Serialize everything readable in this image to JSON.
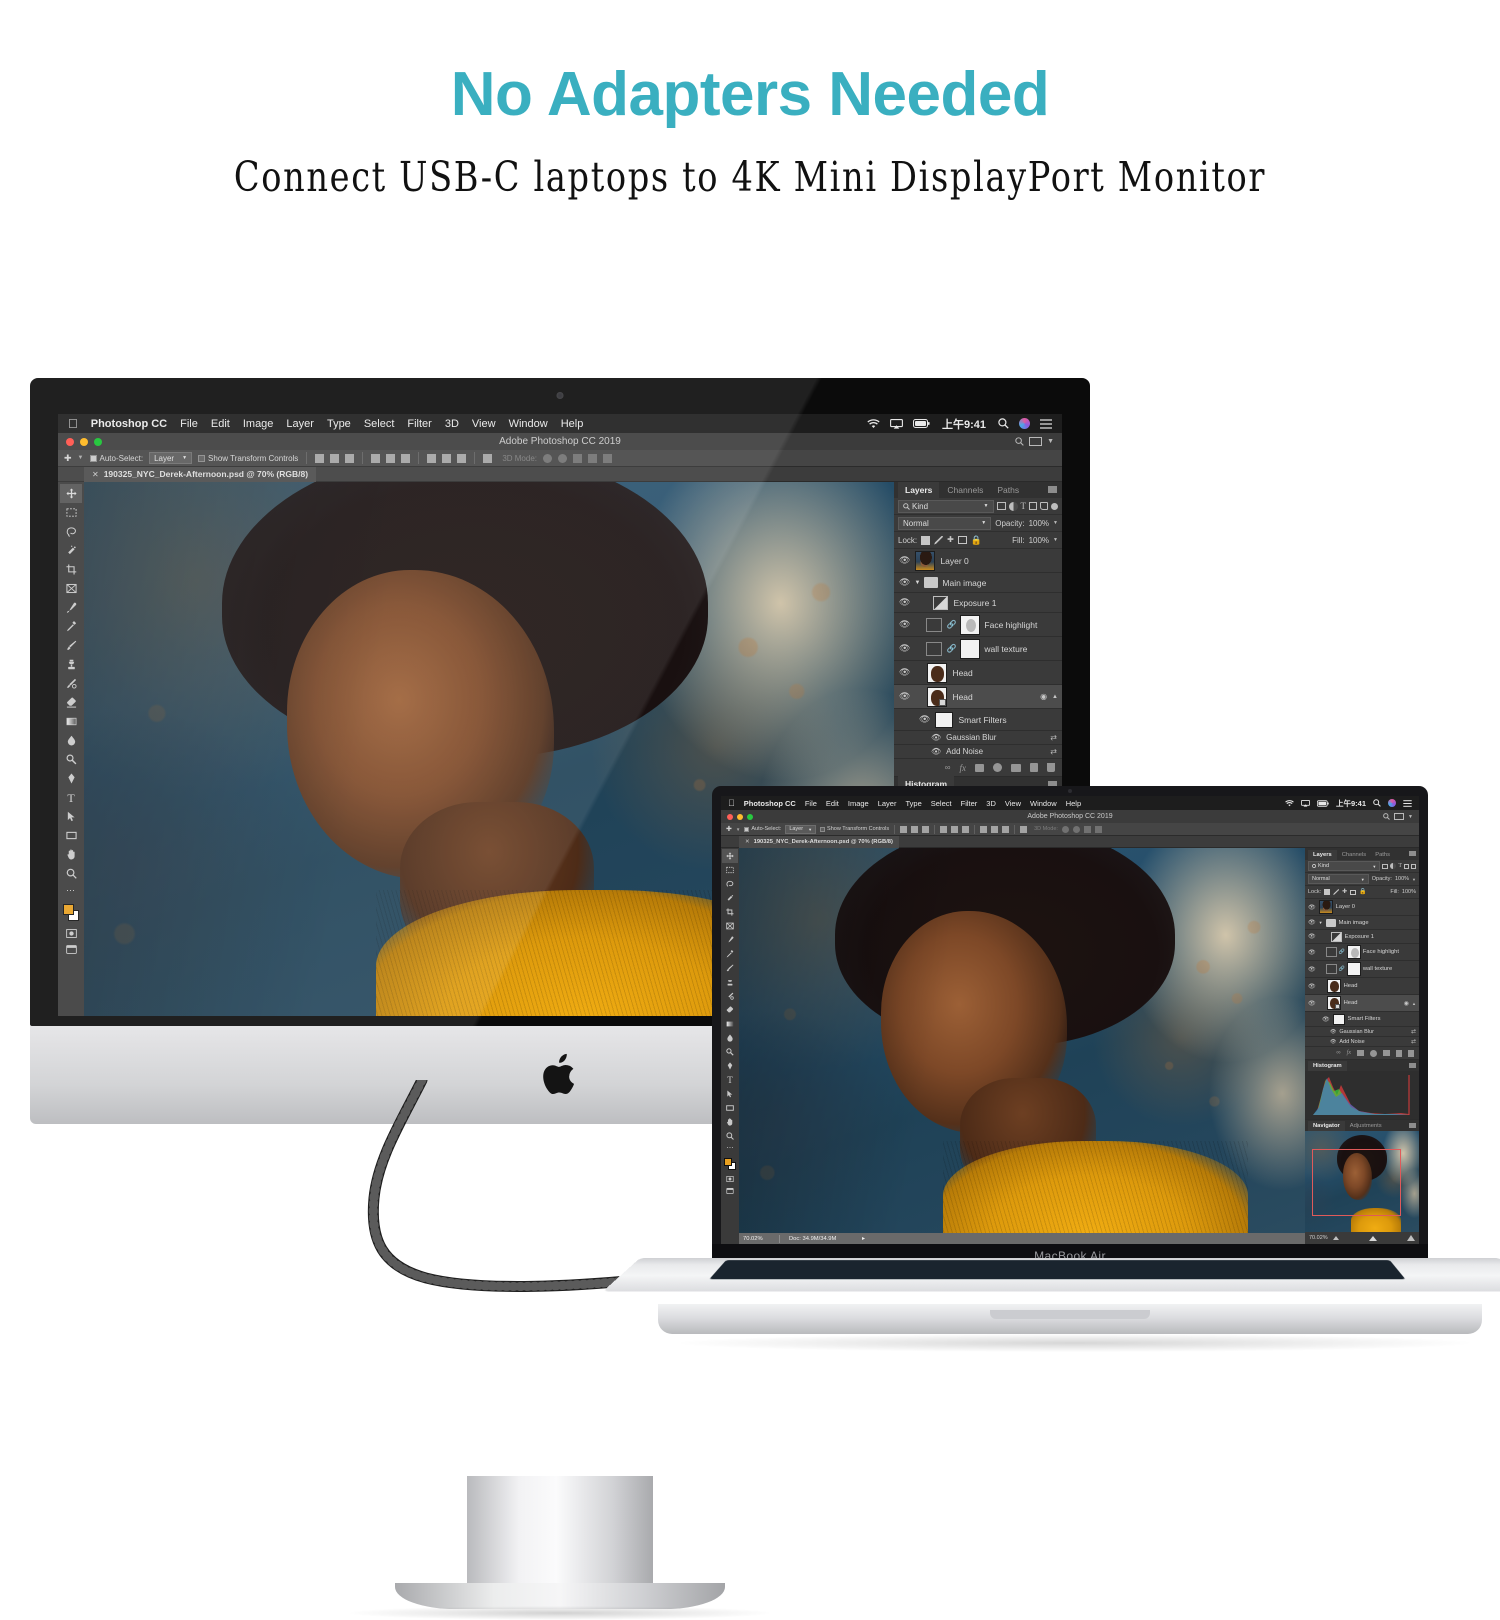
{
  "headline": "No Adapters Needed",
  "subheadline": "Connect USB-C laptops to 4K Mini DisplayPort Monitor",
  "colors": {
    "headline_teal": "#3aafc0",
    "subheadline_black": "#111111",
    "page_background": "#ffffff",
    "ps_panel_gray": "#3a3a3a",
    "ps_menubar_dark": "#1d1d1d",
    "ps_statusbar_gray": "#6a6a6a",
    "sweater_yellow": "#e8a020",
    "wall_blue": "#27506c",
    "nav_viewport_red": "#e05a5a"
  },
  "photoshop": {
    "menubar": {
      "apple_logo": "apple-logo-icon",
      "app_name": "Photoshop CC",
      "items": [
        "File",
        "Edit",
        "Image",
        "Layer",
        "Type",
        "Select",
        "Filter",
        "3D",
        "View",
        "Window",
        "Help"
      ],
      "status_icons": [
        "wifi-icon",
        "airplay-icon",
        "battery-icon"
      ],
      "clock": "上午9:41",
      "right_icons": [
        "search-icon",
        "siri-icon",
        "control-center-icon"
      ]
    },
    "window": {
      "title": "Adobe Photoshop CC 2019",
      "traffic_lights": [
        "close-button",
        "minimize-button",
        "zoom-button"
      ],
      "traffic_colors": [
        "#ff5f57",
        "#febc2e",
        "#28c840"
      ],
      "right_icons": [
        "search-icon",
        "workspace-icon",
        "chevron-down-icon"
      ]
    },
    "options_bar": {
      "tool_icon": "move-tool-icon",
      "auto_select_label": "Auto-Select:",
      "auto_select_checked": true,
      "auto_select_target": "Layer",
      "show_transform_label": "Show Transform Controls",
      "show_transform_checked": false,
      "align_groups": [
        3,
        3,
        3,
        3
      ],
      "mode_3d_label": "3D Mode:",
      "mode_3d_enabled": false,
      "mode_3d_icons": [
        "orbit-3d-icon",
        "roll-3d-icon",
        "pan-3d-icon",
        "slide-3d-icon",
        "scale-3d-icon"
      ]
    },
    "document_tab": {
      "close_icon": "close-icon",
      "title": "190325_NYC_Derek-Afternoon.psd @ 70% (RGB/8)"
    },
    "toolbar": {
      "tools": [
        {
          "name": "move-tool",
          "selected": true
        },
        {
          "name": "marquee-tool",
          "selected": false
        },
        {
          "name": "lasso-tool",
          "selected": false
        },
        {
          "name": "quick-selection-tool",
          "selected": false
        },
        {
          "name": "crop-tool",
          "selected": false
        },
        {
          "name": "frame-tool",
          "selected": false
        },
        {
          "name": "eyedropper-tool",
          "selected": false
        },
        {
          "name": "healing-brush-tool",
          "selected": false
        },
        {
          "name": "brush-tool",
          "selected": false
        },
        {
          "name": "clone-stamp-tool",
          "selected": false
        },
        {
          "name": "history-brush-tool",
          "selected": false
        },
        {
          "name": "eraser-tool",
          "selected": false
        },
        {
          "name": "gradient-tool",
          "selected": false
        },
        {
          "name": "blur-tool",
          "selected": false
        },
        {
          "name": "dodge-tool",
          "selected": false
        },
        {
          "name": "pen-tool",
          "selected": false
        },
        {
          "name": "type-tool",
          "selected": false
        },
        {
          "name": "path-selection-tool",
          "selected": false
        },
        {
          "name": "rectangle-tool",
          "selected": false
        },
        {
          "name": "hand-tool",
          "selected": false
        },
        {
          "name": "zoom-tool",
          "selected": false
        },
        {
          "name": "more-tools",
          "selected": false
        }
      ],
      "foreground_color": "#e8a020",
      "background_color": "#ffffff",
      "bottom_icons": [
        "quick-mask-icon",
        "screen-mode-icon"
      ]
    },
    "layers_panel": {
      "tabs": [
        "Layers",
        "Channels",
        "Paths"
      ],
      "active_tab": "Layers",
      "menu_icon": "panel-menu-icon",
      "filter": {
        "search_icon": "search-icon",
        "kind_label": "Kind",
        "filter_icons": [
          "pixel-filter-icon",
          "adjustment-filter-icon",
          "type-filter-icon",
          "shape-filter-icon",
          "smart-object-filter-icon"
        ],
        "toggle_icon": "filter-toggle-icon"
      },
      "blend_mode": "Normal",
      "opacity_label": "Opacity:",
      "opacity_value": "100%",
      "lock_label": "Lock:",
      "lock_icons": [
        "lock-transparency-icon",
        "lock-image-icon",
        "lock-position-icon",
        "lock-artboard-icon",
        "lock-all-icon"
      ],
      "fill_label": "Fill:",
      "fill_value": "100%",
      "layers": [
        {
          "name": "Layer 0",
          "visible": true,
          "thumb": "photo",
          "indent": 0,
          "selected": false
        },
        {
          "name": "Main image",
          "visible": true,
          "thumb": "folder",
          "indent": 0,
          "selected": false,
          "expanded": true
        },
        {
          "name": "Exposure 1",
          "visible": true,
          "thumb": "adjustment",
          "indent": 1,
          "selected": false
        },
        {
          "name": "Face highlight",
          "visible": true,
          "thumb": "mask",
          "indent": 1,
          "selected": false,
          "linked": true
        },
        {
          "name": "wall texture",
          "visible": true,
          "thumb": "mask",
          "indent": 1,
          "selected": false,
          "linked": true
        },
        {
          "name": "Head",
          "visible": true,
          "thumb": "photo",
          "indent": 1,
          "selected": false
        },
        {
          "name": "Head",
          "visible": true,
          "thumb": "smart",
          "indent": 1,
          "selected": true,
          "smart": true
        },
        {
          "name": "Smart Filters",
          "visible": true,
          "thumb": "white",
          "indent": 2,
          "selected": false
        },
        {
          "name": "Gaussian Blur",
          "visible": true,
          "thumb": "none",
          "indent": 3,
          "selected": false
        },
        {
          "name": "Add Noise",
          "visible": true,
          "thumb": "none",
          "indent": 3,
          "selected": false
        }
      ],
      "footer_icons": [
        "link-layers-icon",
        "layer-style-icon",
        "layer-mask-icon",
        "adjustment-layer-icon",
        "new-group-icon",
        "new-layer-icon",
        "delete-layer-icon"
      ]
    },
    "histogram_panel": {
      "tab": "Histogram",
      "menu_icon": "panel-menu-icon"
    },
    "navigator_panel": {
      "tabs": [
        "Navigator",
        "Adjustments"
      ],
      "active_tab": "Navigator",
      "zoom_value": "70.02%",
      "slider_icons": [
        "zoom-out-icon",
        "zoom-slider-handle",
        "zoom-in-icon"
      ]
    },
    "status_bar": {
      "zoom": "70.02%",
      "doc_info": "Doc: 34.9M/34.9M",
      "expand_icon": "chevron-right-icon"
    }
  },
  "hardware": {
    "imac": {
      "name": "iMac",
      "logo": "apple-logo-icon",
      "camera": "facetime-camera-icon"
    },
    "macbook": {
      "name": "MacBook Air",
      "label": "MacBook Air",
      "camera": "facetime-camera-icon",
      "port": "usb-c-port"
    },
    "cable": {
      "name": "usb-c-to-mini-displayport-cable",
      "style": "braided-nylon",
      "color": "#2a2a2a"
    }
  }
}
